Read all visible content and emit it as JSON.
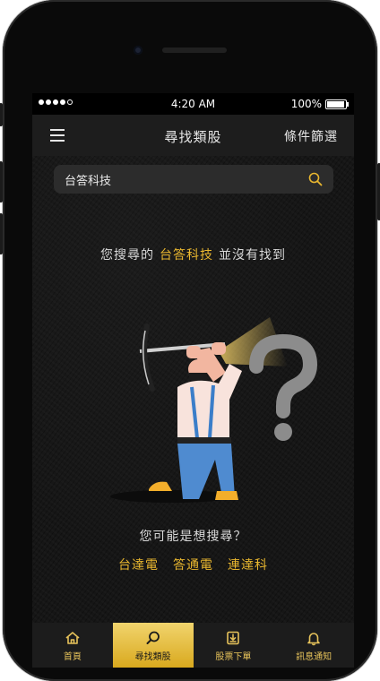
{
  "status_bar": {
    "time": "4:20 AM",
    "battery": "100%",
    "signal_dots": 5
  },
  "nav": {
    "title": "尋找類股",
    "filter_label": "條件篩選"
  },
  "search": {
    "value": "台答科技"
  },
  "result": {
    "prefix": "您搜尋的",
    "keyword": "台答科技",
    "suffix": "並沒有找到"
  },
  "suggestions": {
    "title": "您可能是想搜尋？",
    "items": [
      "台達電",
      "答通電",
      "連達科"
    ]
  },
  "tabs": [
    {
      "label": "首頁",
      "icon": "home-icon",
      "active": false
    },
    {
      "label": "尋找類股",
      "icon": "search-icon",
      "active": true
    },
    {
      "label": "股票下單",
      "icon": "order-icon",
      "active": false
    },
    {
      "label": "訊息通知",
      "icon": "bell-icon",
      "active": false
    }
  ],
  "colors": {
    "accent": "#e9b72f",
    "background": "#161616",
    "navbar": "#1d1d1d",
    "tab_active_top": "#f1d46d",
    "tab_active_bottom": "#d9a91e"
  }
}
